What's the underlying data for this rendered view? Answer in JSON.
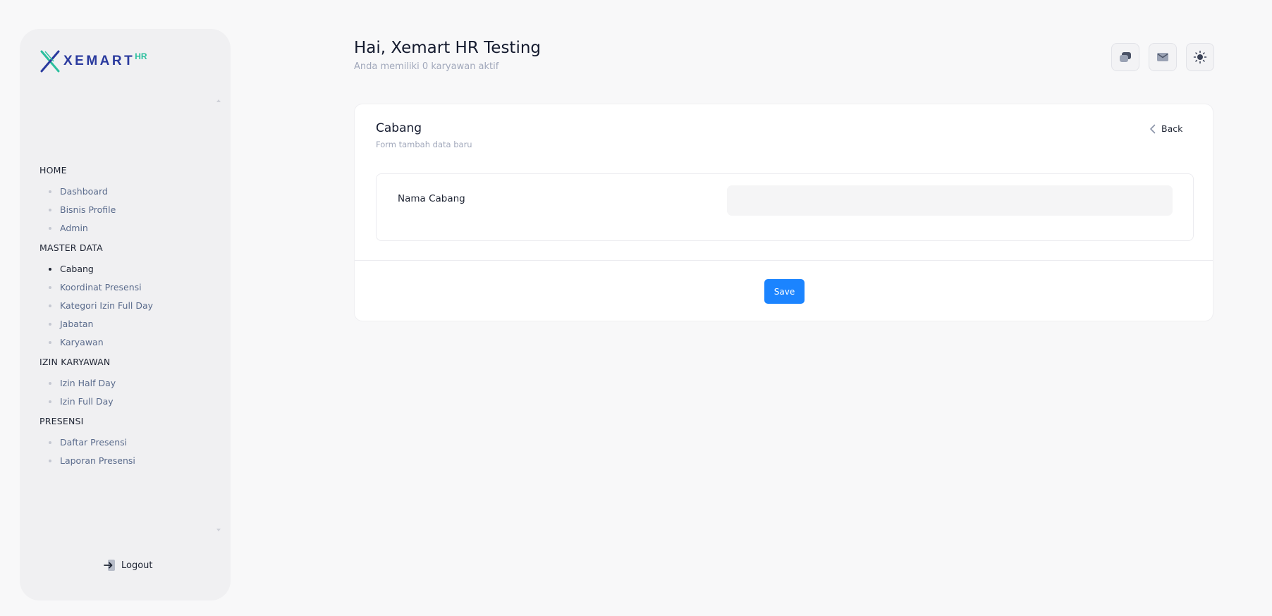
{
  "logo": {
    "text": "XEMART",
    "superscript": "HR",
    "colors": {
      "primary": "#2a3a9e",
      "accent": "#2bbf9e"
    }
  },
  "sidebar": {
    "sections": [
      {
        "title": "HOME",
        "items": [
          "Dashboard",
          "Bisnis Profile",
          "Admin"
        ]
      },
      {
        "title": "MASTER DATA",
        "items": [
          "Cabang",
          "Koordinat Presensi",
          "Kategori Izin Full Day",
          "Jabatan",
          "Karyawan"
        ]
      },
      {
        "title": "IZIN KARYAWAN",
        "items": [
          "Izin Half Day",
          "Izin Full Day"
        ]
      },
      {
        "title": "PRESENSI",
        "items": [
          "Daftar Presensi",
          "Laporan Presensi"
        ]
      }
    ],
    "active_item": "Cabang",
    "logout_label": "Logout"
  },
  "header": {
    "greeting": "Hai, Xemart HR Testing",
    "subtitle": "Anda memiliki 0 karyawan aktif",
    "icons": [
      "chat-icon",
      "mail-icon",
      "sun-icon"
    ]
  },
  "card": {
    "title": "Cabang",
    "subtitle": "Form tambah data baru",
    "back_label": "Back",
    "field_label": "Nama Cabang",
    "field_value": "",
    "field_placeholder": "",
    "save_label": "Save"
  },
  "colors": {
    "save_button": "#1b84ff",
    "background": "#f8f8f9",
    "sidebar": "#f0f0f2"
  }
}
